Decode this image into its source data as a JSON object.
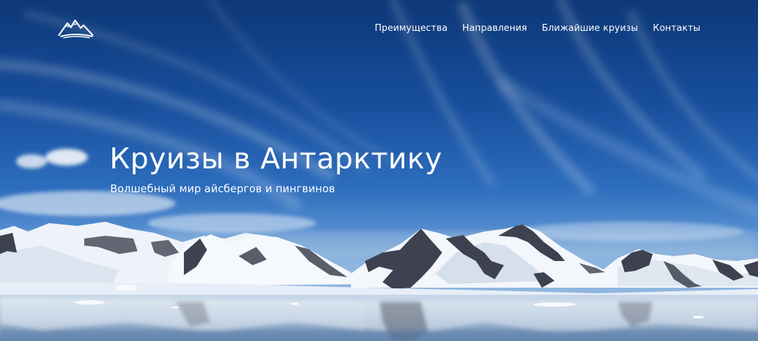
{
  "header": {
    "logo_icon": "mountain-logo-icon",
    "nav": [
      {
        "label": "Преимущества"
      },
      {
        "label": "Направления"
      },
      {
        "label": "Ближайшие круизы"
      },
      {
        "label": "Контакты"
      }
    ]
  },
  "hero": {
    "title": "Круизы в Антарктику",
    "subtitle": "Волшебный мир айсбергов и пингвинов",
    "background_image": "antarctic-mountains-photo",
    "colors": {
      "sky_top": "#0d3878",
      "sky_bottom": "#8fb6df",
      "water": "#b9cee3",
      "snow": "#f4f7fb",
      "rock": "#3a3d48",
      "text": "#ffffff"
    }
  }
}
